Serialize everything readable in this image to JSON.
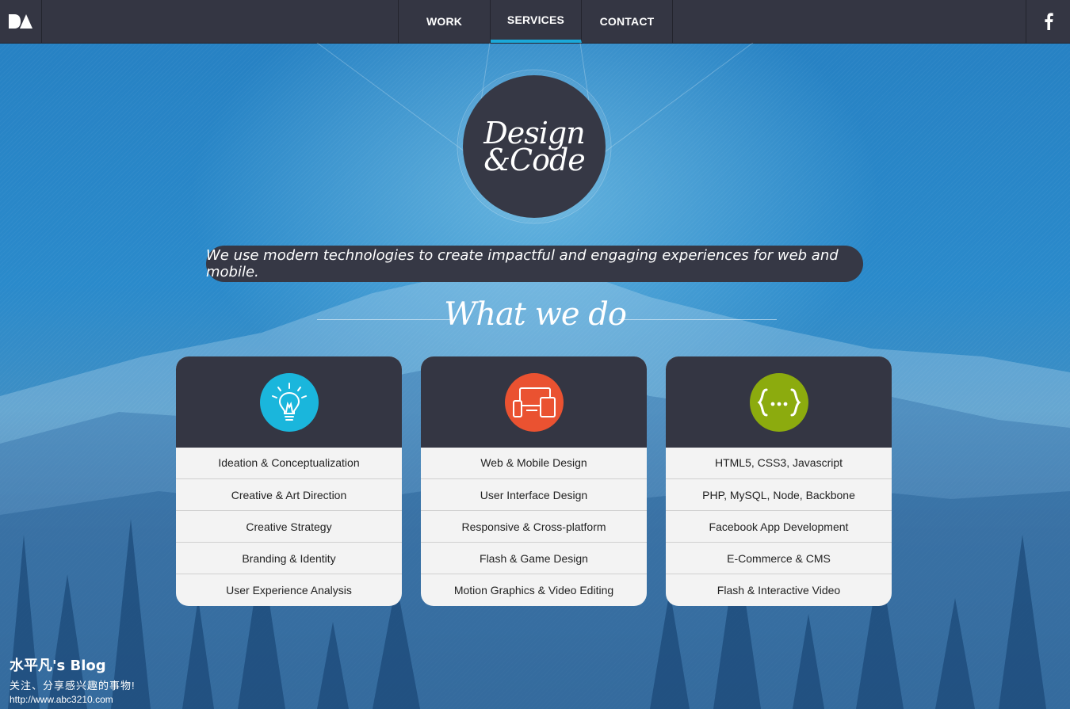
{
  "header": {
    "logo_icon": "da-logo-icon",
    "nav": [
      {
        "label": "WORK",
        "active": false
      },
      {
        "label": "SERVICES",
        "active": true
      },
      {
        "label": "CONTACT",
        "active": false
      }
    ],
    "social_icon": "facebook-icon"
  },
  "hero": {
    "emblem_line1": "Design",
    "emblem_line2": "&Code",
    "tagline": "We use modern technologies to create impactful and engaging experiences for web and mobile."
  },
  "section": {
    "title": "What we do"
  },
  "cards": [
    {
      "icon": "lightbulb-icon",
      "color": "#1ab6dc",
      "items": [
        "Ideation & Conceptualization",
        "Creative & Art Direction",
        "Creative Strategy",
        "Branding & Identity",
        "User Experience Analysis"
      ]
    },
    {
      "icon": "devices-icon",
      "color": "#ea5231",
      "items": [
        "Web & Mobile Design",
        "User Interface Design",
        "Responsive & Cross-platform",
        "Flash & Game Design",
        "Motion Graphics & Video Editing"
      ]
    },
    {
      "icon": "code-braces-icon",
      "color": "#8cab0e",
      "items": [
        "HTML5, CSS3, Javascript",
        "PHP, MySQL, Node, Backbone",
        "Facebook App Development",
        "E-Commerce & CMS",
        "Flash & Interactive Video"
      ]
    }
  ],
  "watermark": {
    "title": "水平凡's Blog",
    "subtitle": "关注、分享感兴趣的事物!",
    "url": "http://www.abc3210.com"
  },
  "colors": {
    "nav_bg": "#343643",
    "accent": "#1ba8d9"
  }
}
